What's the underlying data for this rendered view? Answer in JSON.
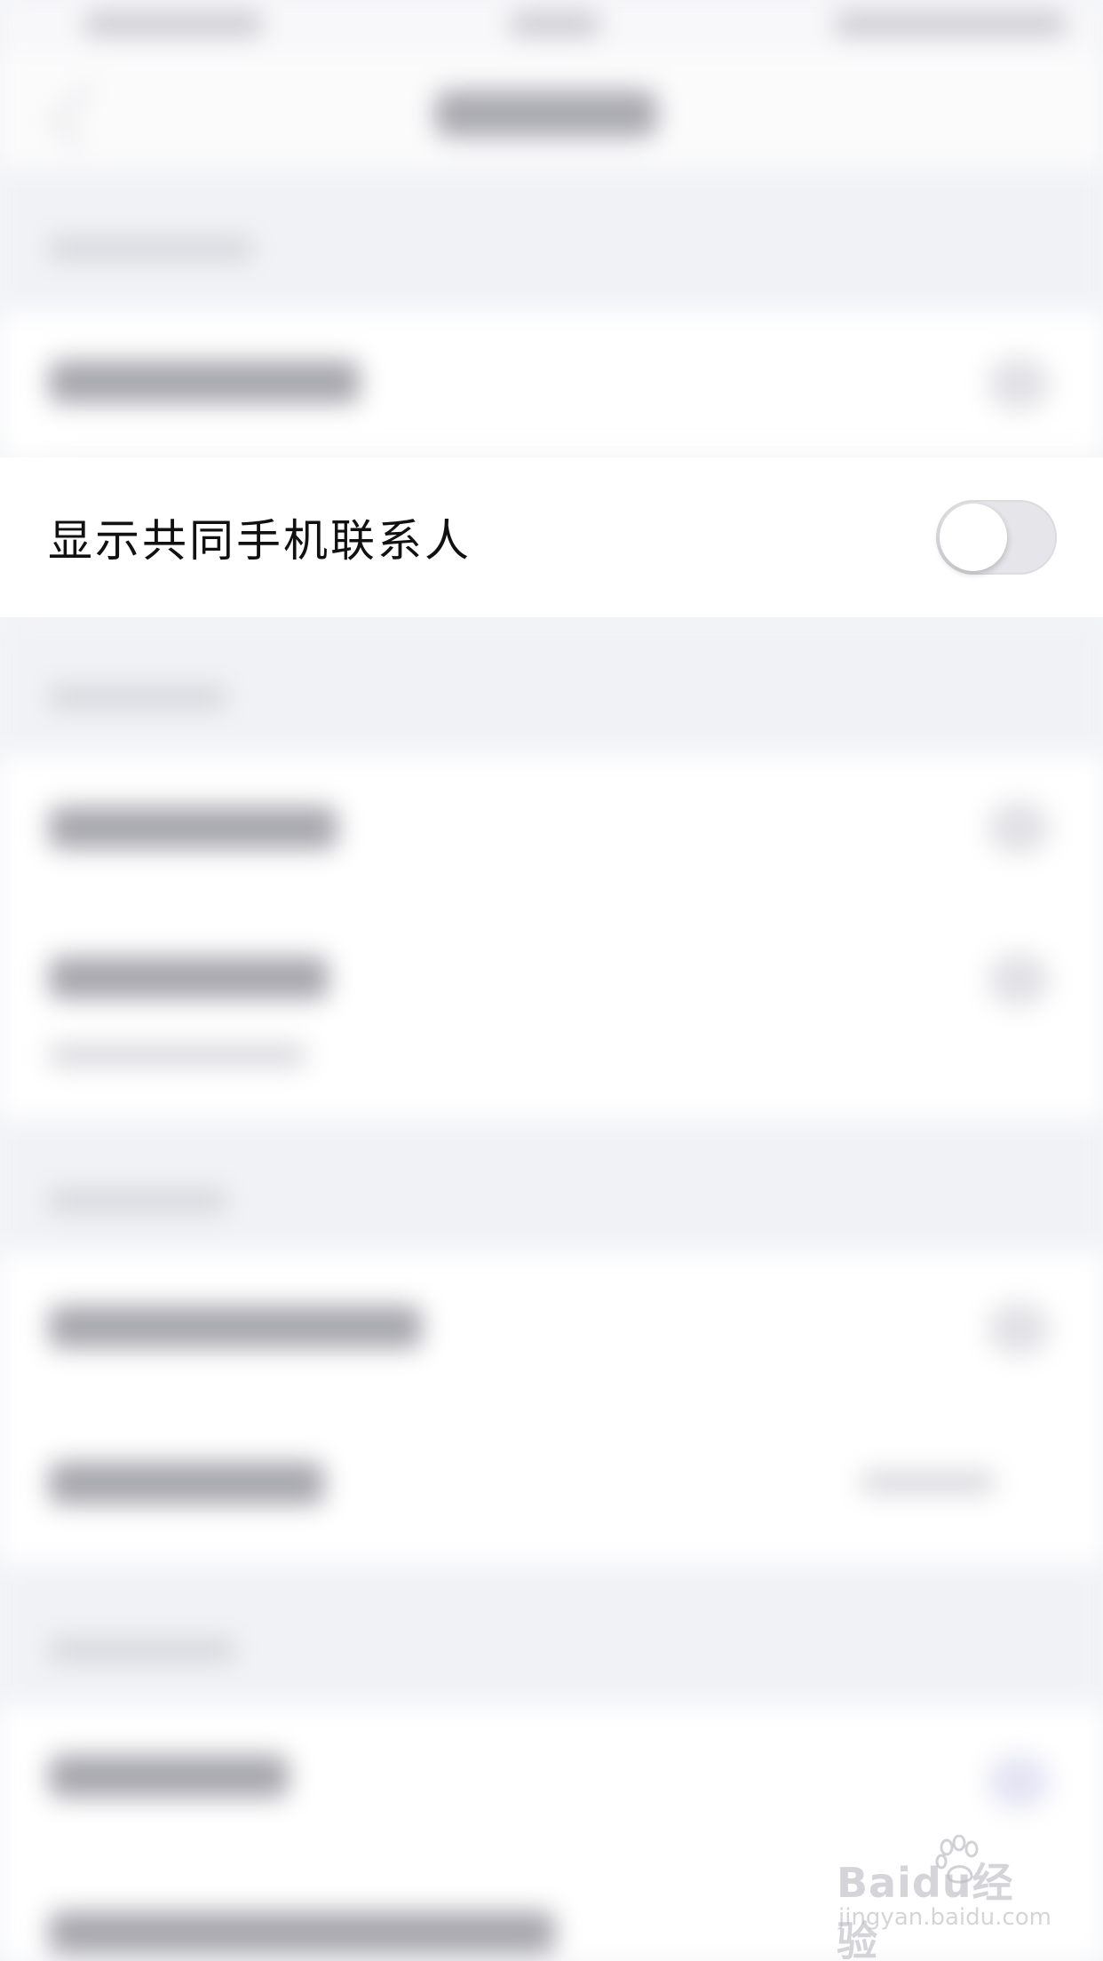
{
  "settings": {
    "visible_row": {
      "label": "显示共同手机联系人",
      "toggle_on": false
    }
  },
  "watermark": {
    "brand": "Baidu经验",
    "domain": "jingyan.baidu.com"
  },
  "colors": {
    "background": "#f3f4f7",
    "row_background": "#ffffff",
    "toggle_off_track": "#e6e6ea",
    "toggle_knob": "#ffffff",
    "label_text": "#111111"
  },
  "icons": {
    "toggle": "switch-toggle-icon",
    "watermark_logo": "baidu-paw-icon"
  }
}
